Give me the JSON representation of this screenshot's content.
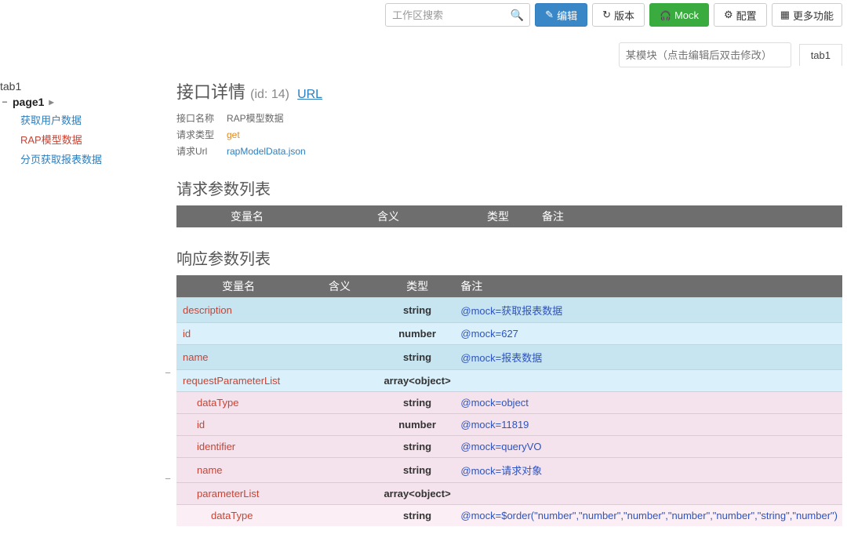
{
  "toolbar": {
    "search_placeholder": "工作区搜索",
    "edit": "编辑",
    "version": "版本",
    "mock": "Mock",
    "config": "配置",
    "more": "更多功能"
  },
  "module_bar": {
    "placeholder": "某模块（点击编辑后双击修改）",
    "tab": "tab1"
  },
  "sidebar": {
    "root": "tab1",
    "page": "page1",
    "items": [
      {
        "label": "获取用户数据",
        "active": false
      },
      {
        "label": "RAP模型数据",
        "active": true
      },
      {
        "label": "分页获取报表数据",
        "active": false
      }
    ]
  },
  "detail": {
    "title": "接口详情",
    "subid": "(id: 14)",
    "url_link": "URL",
    "meta": [
      {
        "label": "接口名称",
        "value": "RAP模型数据",
        "cls": ""
      },
      {
        "label": "请求类型",
        "value": "get",
        "cls": "orange"
      },
      {
        "label": "请求Url",
        "value": "rapModelData.json",
        "cls": "link"
      }
    ]
  },
  "sections": {
    "request_title": "请求参数列表",
    "response_title": "响应参数列表"
  },
  "columns": {
    "var": "变量名",
    "meaning": "含义",
    "type": "类型",
    "note": "备注"
  },
  "response_rows": [
    {
      "indent": 0,
      "rowcls": "row-blue",
      "collapse": false,
      "var": "description",
      "type": "string",
      "note": "@mock=获取报表数据"
    },
    {
      "indent": 0,
      "rowcls": "row-blue-light",
      "collapse": false,
      "var": "id",
      "type": "number",
      "note": "@mock=627"
    },
    {
      "indent": 0,
      "rowcls": "row-blue",
      "collapse": false,
      "var": "name",
      "type": "string",
      "note": "@mock=报表数据"
    },
    {
      "indent": 0,
      "rowcls": "row-blue-light",
      "collapse": true,
      "var": "requestParameterList",
      "type": "array<object>",
      "note": ""
    },
    {
      "indent": 1,
      "rowcls": "row-pink",
      "collapse": false,
      "var": "dataType",
      "type": "string",
      "note": "@mock=object"
    },
    {
      "indent": 1,
      "rowcls": "row-pink",
      "collapse": false,
      "var": "id",
      "type": "number",
      "note": "@mock=11819"
    },
    {
      "indent": 1,
      "rowcls": "row-pink",
      "collapse": false,
      "var": "identifier",
      "type": "string",
      "note": "@mock=queryVO"
    },
    {
      "indent": 1,
      "rowcls": "row-pink",
      "collapse": false,
      "var": "name",
      "type": "string",
      "note": "@mock=请求对象"
    },
    {
      "indent": 1,
      "rowcls": "row-pink",
      "collapse": true,
      "var": "parameterList",
      "type": "array<object>",
      "note": ""
    },
    {
      "indent": 2,
      "rowcls": "row-pink-light",
      "collapse": false,
      "var": "dataType",
      "type": "string",
      "note": "@mock=$order(\"number\",\"number\",\"number\",\"number\",\"number\",\"string\",\"number\")"
    }
  ]
}
